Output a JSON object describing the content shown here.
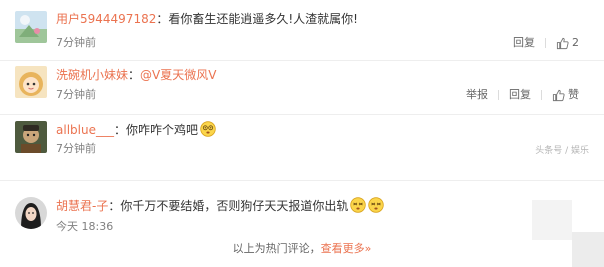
{
  "comments": [
    {
      "username": "用户5944497182",
      "separator": "：",
      "text": "看你畜生还能逍遥多久!人渣就属你!",
      "time": "7分钟前",
      "reply_label": "回复",
      "like_count": "2",
      "like_icon": "thumbs-up-icon"
    },
    {
      "username": "洗碗机小妹妹",
      "separator": "：",
      "text": "@V夏天微风V",
      "time": "7分钟前",
      "report_label": "举报",
      "reply_label": "回复",
      "like_label": "赞",
      "like_icon": "thumbs-up-icon"
    },
    {
      "username": "allblue___",
      "separator": "：",
      "text": "你咋咋个鸡吧",
      "time": "7分钟前",
      "emoji": "dizzy-emoji-icon"
    },
    {
      "username": "胡慧君-子",
      "separator": "：",
      "text": "你千万不要结婚，否则狗仔天天报道你出轨",
      "time": "今天 18:36",
      "emoji": "dizzy-emoji-icon"
    }
  ],
  "watermark": "头条号 / 娱乐",
  "footer": {
    "hot_label": "以上为热门评论，",
    "more_label": "查看更多",
    "more_suffix": "»"
  },
  "colors": {
    "username": "#eb7350",
    "text": "#333333",
    "time": "#808080",
    "divider": "#eeeeee"
  }
}
